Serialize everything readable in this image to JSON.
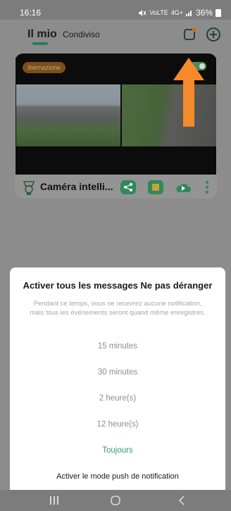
{
  "status_bar": {
    "time": "16:16",
    "network_labels": "VoLTE",
    "signal": "4G+",
    "battery": "36%"
  },
  "header": {
    "tab_mine": "Il mio",
    "tab_shared": "Condiviso"
  },
  "camera_card": {
    "status_badge": "Ibernazione",
    "name": "Caméra intelli...",
    "toggle_on": true
  },
  "sheet": {
    "title": "Activer tous les messages Ne pas déranger",
    "description": "Pendant ce temps, vous ne recevrez aucune notification, mais tous les événements seront quand même enregistrés.",
    "options": [
      "15 minutes",
      "30 minutes",
      "2 heure(s)",
      "12 heure(s)",
      "Toujours"
    ],
    "push_mode": "Activer le mode push de notification"
  },
  "colors": {
    "accent": "#2f9a7a",
    "arrow": "#f58a2a",
    "card_icon_green": "#2f8a5a",
    "badge_brown": "#7a4f1c"
  },
  "icons": {
    "header": [
      "notification-card-icon",
      "add-icon"
    ],
    "card_footer": [
      "camera-logo-icon",
      "share-icon",
      "gallery-icon",
      "cloud-play-icon",
      "more-icon"
    ],
    "nav": [
      "recent-apps-icon",
      "home-icon",
      "back-icon"
    ]
  }
}
